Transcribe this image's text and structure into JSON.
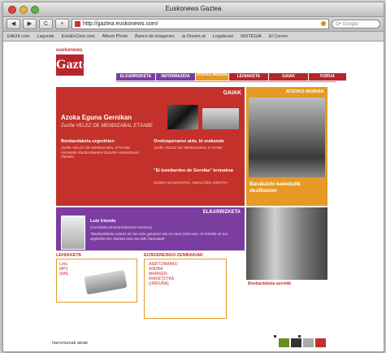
{
  "window": {
    "title": "Euskonews Gaztea"
  },
  "toolbar": {
    "back": "◀",
    "forward": "▶",
    "reload": "C",
    "add": "+",
    "url": "http://gaztea.euskonews.com/",
    "search_placeholder": "Q• Google"
  },
  "bookmarks": [
    "Eitb24.com",
    "Lagunak",
    "EstaEnCine.com",
    "Album Photo",
    "Banco de imagenes",
    "ar Dream.at",
    "Logatecas",
    "INSTEGIA",
    "El Correo"
  ],
  "site": {
    "logo_top": "euskonews",
    "logo_main": "Gaztea",
    "nav": [
      "ELKARRIZKETA",
      "INFORMAZIOA",
      "ATZOKO IRUDIAK",
      "LEHIAKETA",
      "GAIAK",
      "FORUA"
    ],
    "gaiak": {
      "header": "GAIAK",
      "title": "Azoka Eguna Gernikan",
      "author": "Zuriñe VELEZ DE MENDIZABAL ETXABE",
      "a1_title": "Bonbardaketa urgezkiten",
      "a1_text": "Zuriñe VELEZ DE MENDIZABAL ETXABE, Gernikako Bonbardaketari buruzko Hakuntzaren Zientzia",
      "a2_title": "Oroitzapenaren alde, bi erakunde",
      "a2_text": "Zuriñe VELEZ DE MENDIZABAL ETXABE",
      "a3_title": "\"El bombardeo de Gernika\" kronakoa",
      "a3_text": "EUSKO IKASKUNTZA, INDALTZIG ARRATIA"
    },
    "atzoko": {
      "header": "ATZOKO IRUDIAK",
      "caption": "Barakaldo kaleetatik desfilatzen"
    },
    "elkarrizketa": {
      "header": "ELKARRIZKETA",
      "name": "Luis Iriondo",
      "role": "(Gernikako Bonbardaketaren lekukoa)",
      "quote": "\"Bonbardaketa ostean ez zen ezer geratzen eta ez zuen inork ezer, ez kriseilu ez ura argitzeko ere; kaletan ezin zen ibili, hareatzak\""
    },
    "bonbardaketa_caption": "Bonbardaketa aurretik",
    "lehiaketa": {
      "label": "LEHIAKETA",
      "links": [
        "Lotu",
        "MP3",
        "SMS"
      ]
    },
    "euskera": {
      "label": "EUSKERENGO ZENBAKIAK",
      "links": [
        "AIERTZAMAKO",
        "ANDRA",
        "MARIKEN",
        "IRAKETZYKA",
        "(URDUÑA)"
      ]
    }
  },
  "footer": {
    "text": "harremanak   aleak"
  }
}
